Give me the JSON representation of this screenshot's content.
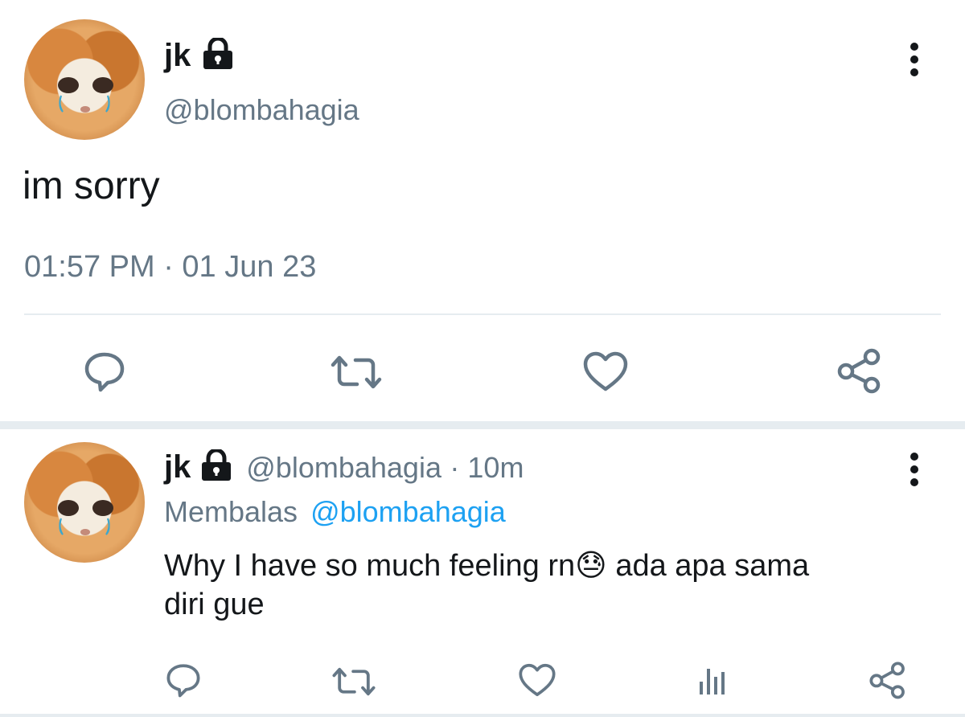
{
  "main_tweet": {
    "display_name": "jk",
    "handle": "@blombahagia",
    "text": "im sorry",
    "timestamp": "01:57 PM · 01 Jun 23"
  },
  "reply_tweet": {
    "display_name": "jk",
    "handle": "@blombahagia",
    "time_ago": "· 10m",
    "replying_label": "Membalas",
    "replying_to": "@blombahagia",
    "text_line1": "Why I have so much feeling rn",
    "emoji": "😓",
    "text_line1_after": " ada apa sama",
    "text_line2": "diri gue"
  },
  "icons": {
    "lock": "lock-icon",
    "more": "more-vertical-icon",
    "reply": "reply-icon",
    "retweet": "retweet-icon",
    "like": "heart-icon",
    "share": "share-icon",
    "analytics": "analytics-icon"
  },
  "colors": {
    "text": "#14171a",
    "muted": "#657786",
    "link": "#1da1f2",
    "divider": "#e6ecf0"
  }
}
